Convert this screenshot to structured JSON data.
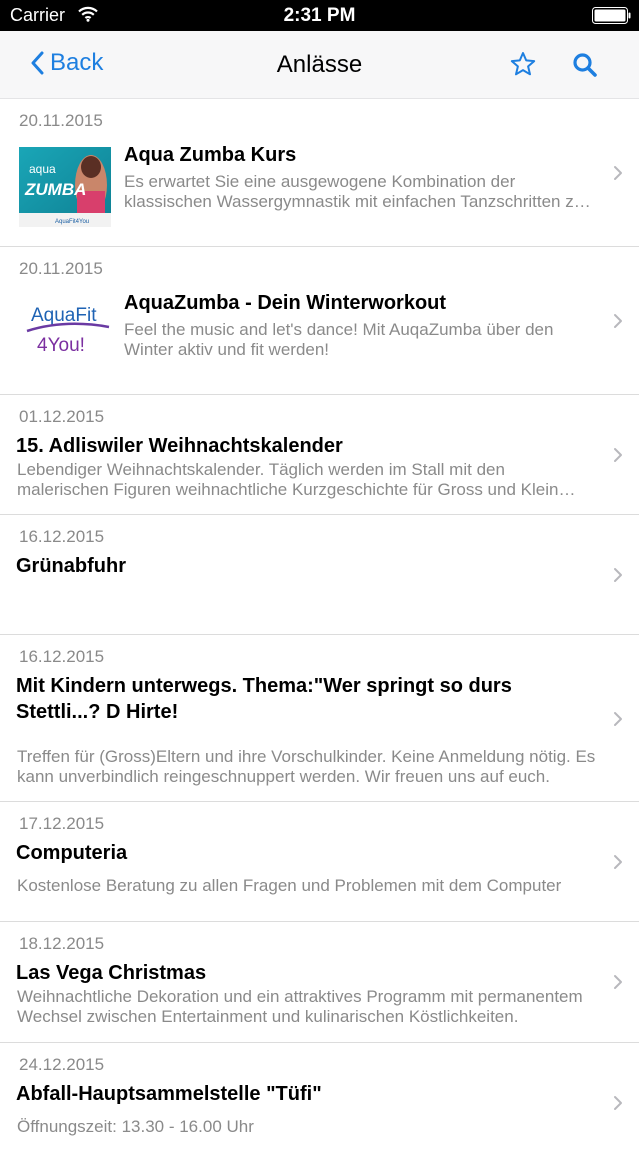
{
  "status": {
    "carrier": "Carrier",
    "time": "2:31 PM"
  },
  "nav": {
    "back_label": "Back",
    "title": "Anlässe"
  },
  "thumbs": {
    "aqua_zumba": {
      "logo_text_aqua": "aqua",
      "logo_text_zumba": "ZUMBA",
      "logo_text_small": "AquaFit4You"
    },
    "aquafit": {
      "line1": "AquaFit",
      "line2": "4You!"
    }
  },
  "events": [
    {
      "date": "20.11.2015",
      "title": "Aqua Zumba Kurs",
      "desc": "Es erwartet Sie eine ausgewogene Kombination der klassischen Wassergymnastik mit einfachen Tanzschritten zu heissen Rhythmen."
    },
    {
      "date": "20.11.2015",
      "title": "AquaZumba - Dein Winterworkout",
      "desc": "Feel the music and let's dance! Mit AuqaZumba über den Winter aktiv und fit werden!"
    },
    {
      "date": "01.12.2015",
      "title": "15. Adliswiler Weihnachtskalender",
      "desc": "Lebendiger Weihnachtskalender. Täglich werden im Stall mit den malerischen Figuren weihnachtliche Kurzgeschichte für Gross und Klein erzählt."
    },
    {
      "date": "16.12.2015",
      "title": "Grünabfuhr",
      "desc": ""
    },
    {
      "date": "16.12.2015",
      "title": "Mit Kindern unterwegs. Thema:\"Wer springt so durs Stettli...? D Hirte!",
      "desc": "Treffen für (Gross)Eltern und ihre Vorschulkinder. Keine Anmeldung nötig. Es kann unverbindlich reingeschnuppert werden. Wir freuen uns auf euch."
    },
    {
      "date": "17.12.2015",
      "title": "Computeria",
      "desc": "Kostenlose Beratung zu allen Fragen und Problemen mit dem Computer"
    },
    {
      "date": "18.12.2015",
      "title": "Las Vega Christmas",
      "desc": "Weihnachtliche Dekoration und ein attraktives Programm mit permanentem Wechsel zwischen Entertainment und kulinarischen Köstlichkeiten."
    },
    {
      "date": "24.12.2015",
      "title": "Abfall-Hauptsammelstelle \"Tüfi\"",
      "desc": "Öffnungszeit: 13.30 - 16.00 Uhr"
    }
  ],
  "colors": {
    "accent": "#1e7fe0",
    "secondary_text": "#8a8a8a",
    "separator": "#dcdcdc",
    "nav_bg": "#f7f7f8"
  },
  "icons": {
    "back": "chevron-left-icon",
    "favorite": "star-icon",
    "search": "search-icon",
    "disclosure": "chevron-right-icon"
  }
}
